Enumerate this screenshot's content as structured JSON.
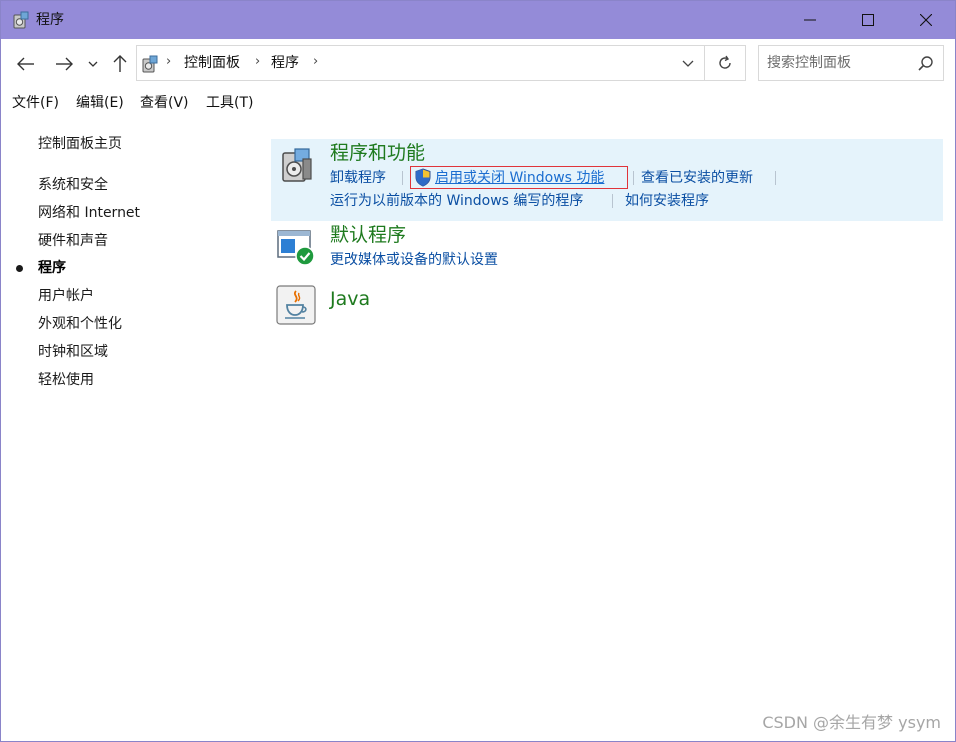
{
  "window": {
    "title": "程序",
    "controls": [
      "minimize",
      "maximize",
      "close"
    ]
  },
  "navigation": {
    "icons": [
      "back-arrow-icon",
      "forward-arrow-icon",
      "recent-dropdown-icon",
      "up-arrow-icon"
    ]
  },
  "address": {
    "breadcrumb": [
      "控制面板",
      "程序"
    ]
  },
  "search": {
    "placeholder": "搜索控制面板"
  },
  "menubar": {
    "items": [
      "文件(F)",
      "编辑(E)",
      "查看(V)",
      "工具(T)"
    ]
  },
  "sidebar": {
    "home": "控制面板主页",
    "items": [
      {
        "label": "系统和安全",
        "active": false
      },
      {
        "label": "网络和 Internet",
        "active": false
      },
      {
        "label": "硬件和声音",
        "active": false
      },
      {
        "label": "程序",
        "active": true
      },
      {
        "label": "用户帐户",
        "active": false
      },
      {
        "label": "外观和个性化",
        "active": false
      },
      {
        "label": "时钟和区域",
        "active": false
      },
      {
        "label": "轻松使用",
        "active": false
      }
    ]
  },
  "categories": [
    {
      "title": "程序和功能",
      "icon": "programs-features-icon",
      "links_row1": [
        "卸载程序",
        "启用或关闭 Windows 功能",
        "查看已安装的更新"
      ],
      "links_row2": [
        "运行为以前版本的 Windows 编写的程序",
        "如何安装程序"
      ]
    },
    {
      "title": "默认程序",
      "icon": "default-programs-icon",
      "links_row1": [
        "更改媒体或设备的默认设置"
      ]
    },
    {
      "title": "Java",
      "icon": "java-icon"
    }
  ],
  "colors": {
    "titlebar": "#948bd8",
    "category_title": "#1e7a1e",
    "link": "#0b4fa3",
    "highlight": "#e5f3fb",
    "annotation_box": "#e0343a"
  },
  "watermark": "CSDN @余生有梦 ysym"
}
